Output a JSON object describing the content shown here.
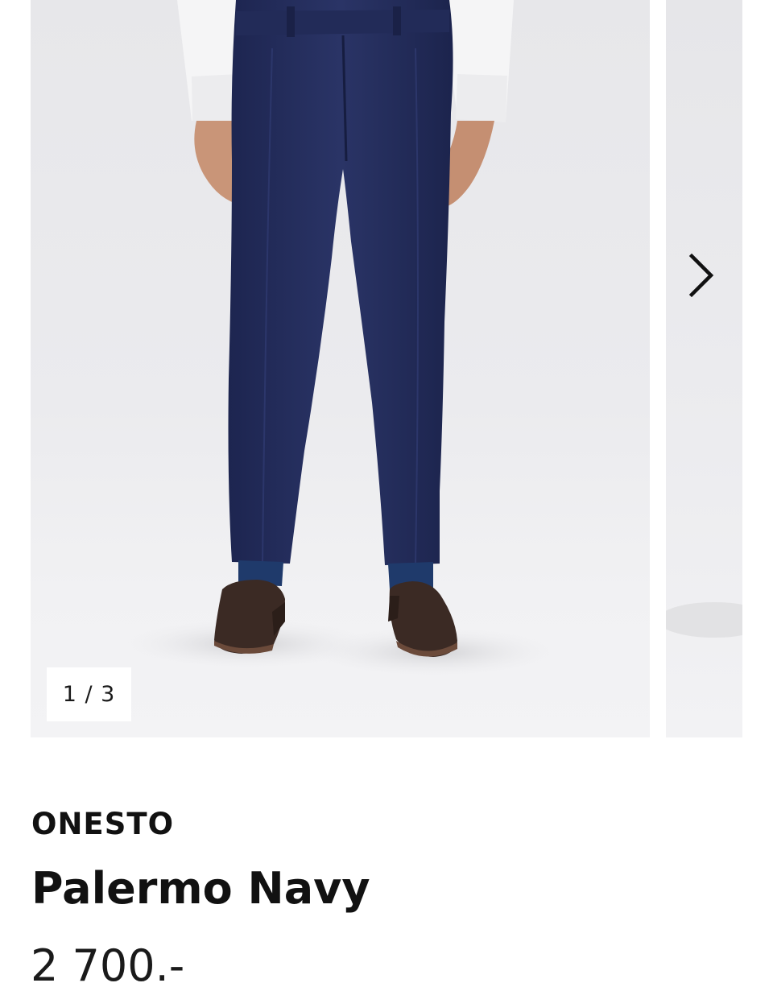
{
  "gallery": {
    "counter": "1 / 3",
    "current_index": 1,
    "total": 3,
    "next_icon": "chevron-right-icon",
    "image_subject": "product-photo-navy-trousers"
  },
  "product": {
    "brand": "ONESTO",
    "name": "Palermo Navy",
    "price": "2 700.-"
  },
  "colors": {
    "trousers": "#232c5a",
    "shirt": "#f4f4f4",
    "shoes": "#3b2a24",
    "background": "#ebebee"
  }
}
